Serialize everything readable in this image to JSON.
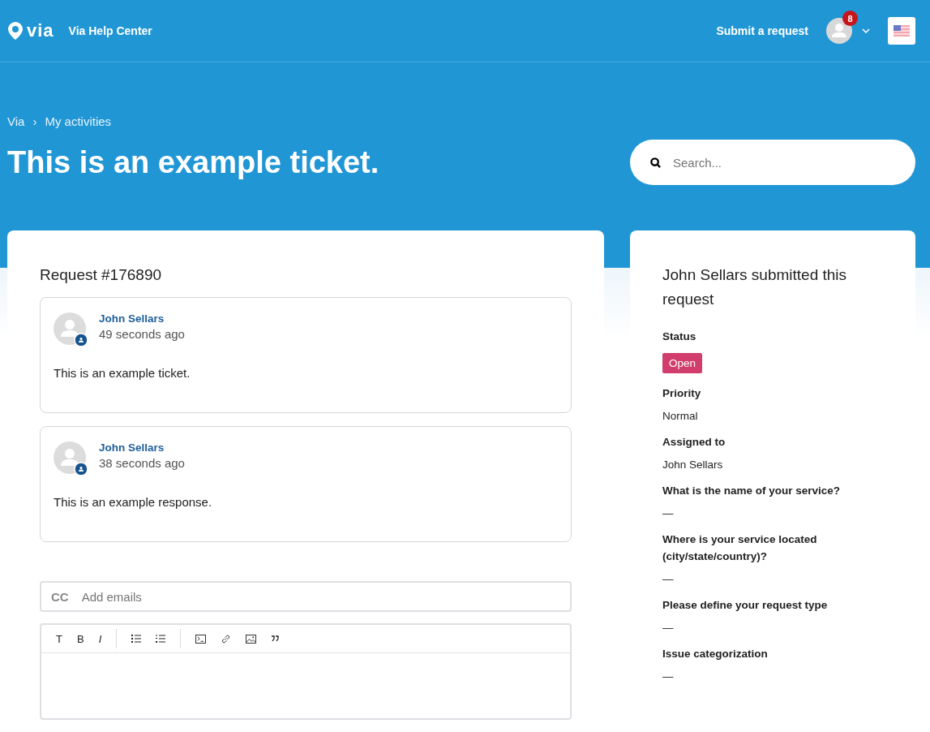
{
  "header": {
    "logo": "via",
    "site_name": "Via Help Center",
    "submit_link": "Submit a request",
    "notification_count": "8"
  },
  "breadcrumbs": [
    "Via",
    "My activities"
  ],
  "breadcrumb_separator": "›",
  "page_title": "This is an example ticket.",
  "search": {
    "placeholder": "Search..."
  },
  "request": {
    "title": "Request #176890",
    "comments": [
      {
        "author": "John Sellars",
        "time": "49 seconds ago",
        "body": "This is an example ticket."
      },
      {
        "author": "John Sellars",
        "time": "38 seconds ago",
        "body": "This is an example response."
      }
    ],
    "cc": {
      "label": "CC",
      "placeholder": "Add emails"
    },
    "toolbar": [
      [
        {
          "kind": "heading",
          "label": "T"
        },
        {
          "kind": "bold",
          "label": "B"
        },
        {
          "kind": "italic",
          "label": "I"
        }
      ],
      [
        {
          "kind": "bullets"
        },
        {
          "kind": "numbers"
        }
      ],
      [
        {
          "kind": "code"
        },
        {
          "kind": "link"
        },
        {
          "kind": "image"
        },
        {
          "kind": "quote"
        }
      ]
    ]
  },
  "details": {
    "title": "John Sellars submitted this request",
    "fields": [
      {
        "kind": "status",
        "label": "Status",
        "value": "Open",
        "color": "#d13d6c"
      },
      {
        "kind": "text",
        "label": "Priority",
        "value": "Normal"
      },
      {
        "kind": "text",
        "label": "Assigned to",
        "value": "John Sellars"
      },
      {
        "kind": "text",
        "label": "What is the name of your service?",
        "value": "—"
      },
      {
        "kind": "text",
        "label": "Where is your service located (city/state/country)?",
        "value": "—"
      },
      {
        "kind": "text",
        "label": "Please define your request type",
        "value": "—"
      },
      {
        "kind": "text",
        "label": "Issue categorization",
        "value": "—"
      }
    ]
  }
}
